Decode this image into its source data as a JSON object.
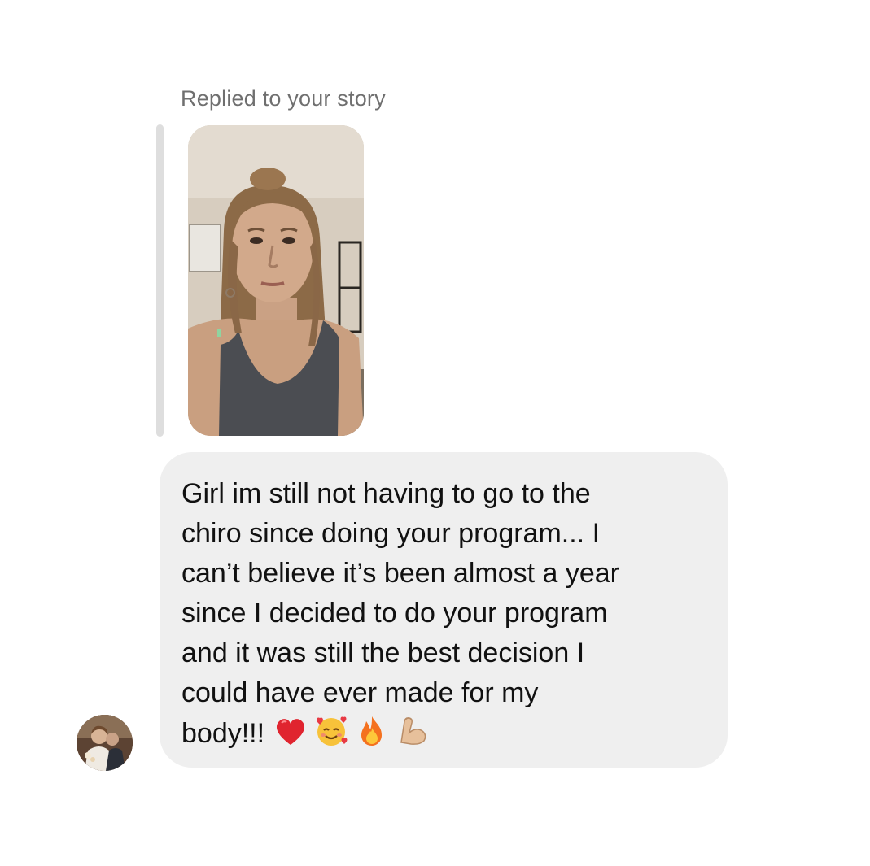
{
  "story_reply": {
    "label": "Replied to your story",
    "thumbnail_icon": "story-photo-thumbnail"
  },
  "message": {
    "text": "Girl im still not having to go to the\nchiro since doing your program... I\ncan’t believe it’s been almost a year\nsince I decided to do your program\nand it was still the best decision I\ncould have ever made for my\nbody!!!",
    "emojis": [
      "red-heart-icon",
      "smiling-face-with-hearts-icon",
      "fire-icon",
      "flexed-biceps-icon"
    ]
  },
  "sender": {
    "avatar_icon": "sender-avatar"
  },
  "colors": {
    "bubble": "#efefef",
    "reply_bar": "#dedede",
    "label": "#6f6f6f",
    "text": "#111111"
  }
}
